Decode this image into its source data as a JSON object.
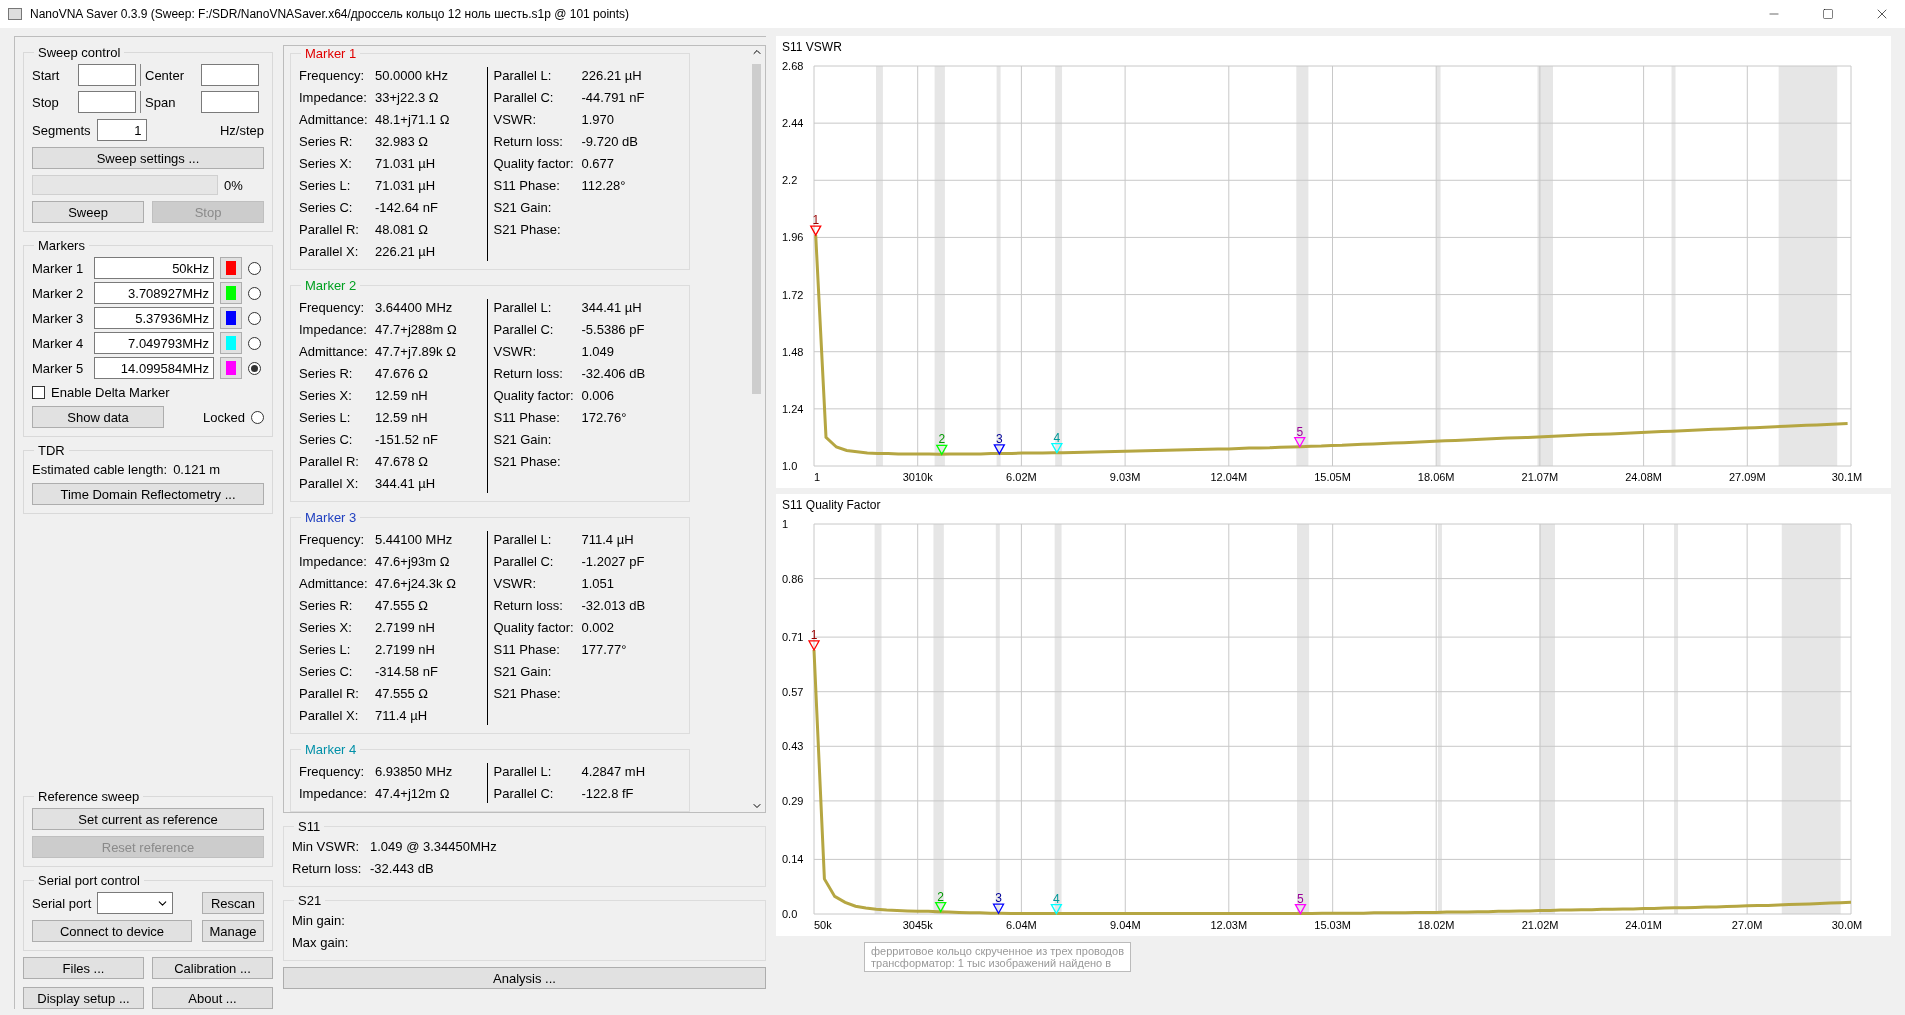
{
  "window": {
    "title": "NanoVNA Saver 0.3.9 (Sweep: F:/SDR/NanoVNASaver.x64/дроссель кольцо 12 ноль шесть.s1p @ 101 points)"
  },
  "sweep_control": {
    "title": "Sweep control",
    "start": "Start",
    "center": "Center",
    "stop": "Stop",
    "span": "Span",
    "segments": {
      "label": "Segments",
      "value": "1"
    },
    "unit": "Hz/step",
    "settings_button": "Sweep settings ...",
    "progress": {
      "level": 0,
      "reading": "0%"
    },
    "buttons": [
      {
        "label": "Sweep",
        "disabled": false
      },
      {
        "label": "Stop",
        "disabled": true
      }
    ]
  },
  "markers": {
    "title": "Markers",
    "items": [
      {
        "label": "Marker 1",
        "value": "50kHz",
        "color": "#ff0000",
        "selected": false
      },
      {
        "label": "Marker 2",
        "value": "3.708927MHz",
        "color": "#00ff00",
        "selected": false
      },
      {
        "label": "Marker 3",
        "value": "5.37936MHz",
        "color": "#0000ff",
        "selected": false
      },
      {
        "label": "Marker 4",
        "value": "7.049793MHz",
        "color": "#00ffff",
        "selected": false
      },
      {
        "label": "Marker 5",
        "value": "14.099584MHz",
        "color": "#ff00ff",
        "selected": true
      }
    ],
    "delta": {
      "label": "Enable Delta Marker",
      "checked": false
    },
    "show_data": "Show data",
    "locked": {
      "label": "Locked",
      "checked": false
    }
  },
  "tdr": {
    "title": "TDR",
    "label": "Estimated cable length:",
    "value": "0.121 m",
    "button": "Time Domain Reflectometry ..."
  },
  "reference_sweep": {
    "title": "Reference sweep",
    "buttons": [
      {
        "label": "Set current as reference",
        "disabled": false
      },
      {
        "label": "Reset reference",
        "disabled": true
      }
    ]
  },
  "serial_port": {
    "title": "Serial port control",
    "label": "Serial port",
    "rescan": "Rescan",
    "connect": "Connect to device",
    "manage": "Manage"
  },
  "bottom_buttons": [
    "Files ...",
    "Calibration ...",
    "Display setup ...",
    "About ..."
  ],
  "marker_data": [
    {
      "title": "Marker 1",
      "color": "#e00000",
      "left": [
        {
          "label": "Frequency:",
          "value": "50.0000 kHz"
        },
        {
          "label": "Impedance:",
          "value": "33+j22.3 Ω"
        },
        {
          "label": "Admittance:",
          "value": "48.1+j71.1 Ω"
        },
        {
          "label": "Series R:",
          "value": "32.983 Ω"
        },
        {
          "label": "Series X:",
          "value": "71.031 µH"
        },
        {
          "label": "Series L:",
          "value": "71.031 µH"
        },
        {
          "label": "Series C:",
          "value": "-142.64 nF"
        },
        {
          "label": "Parallel R:",
          "value": "48.081 Ω"
        },
        {
          "label": "Parallel X:",
          "value": "226.21 µH"
        }
      ],
      "right": [
        {
          "label": "Parallel L:",
          "value": "226.21 µH"
        },
        {
          "label": "Parallel C:",
          "value": "-44.791 nF"
        },
        {
          "label": "VSWR:",
          "value": "1.970"
        },
        {
          "label": "Return loss:",
          "value": "-9.720 dB"
        },
        {
          "label": "Quality factor:",
          "value": "0.677"
        },
        {
          "label": "S11 Phase:",
          "value": "112.28°"
        },
        {
          "label": "S21 Gain:"
        },
        {
          "label": "S21 Phase:"
        }
      ]
    },
    {
      "title": "Marker 2",
      "color": "#00a020",
      "left": [
        {
          "label": "Frequency:",
          "value": "3.64400 MHz"
        },
        {
          "label": "Impedance:",
          "value": "47.7+j288m Ω"
        },
        {
          "label": "Admittance:",
          "value": "47.7+j7.89k Ω"
        },
        {
          "label": "Series R:",
          "value": "47.676 Ω"
        },
        {
          "label": "Series X:",
          "value": "12.59 nH"
        },
        {
          "label": "Series L:",
          "value": "12.59 nH"
        },
        {
          "label": "Series C:",
          "value": "-151.52 nF"
        },
        {
          "label": "Parallel R:",
          "value": "47.678 Ω"
        },
        {
          "label": "Parallel X:",
          "value": "344.41 µH"
        }
      ],
      "right": [
        {
          "label": "Parallel L:",
          "value": "344.41 µH"
        },
        {
          "label": "Parallel C:",
          "value": "-5.5386 pF"
        },
        {
          "label": "VSWR:",
          "value": "1.049"
        },
        {
          "label": "Return loss:",
          "value": "-32.406 dB"
        },
        {
          "label": "Quality factor:",
          "value": "0.006"
        },
        {
          "label": "S11 Phase:",
          "value": "172.76°"
        },
        {
          "label": "S21 Gain:"
        },
        {
          "label": "S21 Phase:"
        }
      ]
    },
    {
      "title": "Marker 3",
      "color": "#2040c0",
      "left": [
        {
          "label": "Frequency:",
          "value": "5.44100 MHz"
        },
        {
          "label": "Impedance:",
          "value": "47.6+j93m Ω"
        },
        {
          "label": "Admittance:",
          "value": "47.6+j24.3k Ω"
        },
        {
          "label": "Series R:",
          "value": "47.555 Ω"
        },
        {
          "label": "Series X:",
          "value": "2.7199 nH"
        },
        {
          "label": "Series L:",
          "value": "2.7199 nH"
        },
        {
          "label": "Series C:",
          "value": "-314.58 nF"
        },
        {
          "label": "Parallel R:",
          "value": "47.555 Ω"
        },
        {
          "label": "Parallel X:",
          "value": "711.4 µH"
        }
      ],
      "right": [
        {
          "label": "Parallel L:",
          "value": "711.4 µH"
        },
        {
          "label": "Parallel C:",
          "value": "-1.2027 pF"
        },
        {
          "label": "VSWR:",
          "value": "1.051"
        },
        {
          "label": "Return loss:",
          "value": "-32.013 dB"
        },
        {
          "label": "Quality factor:",
          "value": "0.002"
        },
        {
          "label": "S11 Phase:",
          "value": "177.77°"
        },
        {
          "label": "S21 Gain:"
        },
        {
          "label": "S21 Phase:"
        }
      ]
    },
    {
      "title": "Marker 4",
      "color": "#0090a8",
      "left": [
        {
          "label": "Frequency:",
          "value": "6.93850 MHz"
        },
        {
          "label": "Impedance:",
          "value": "47.4+j12m Ω"
        }
      ],
      "right": [
        {
          "label": "Parallel L:",
          "value": "4.2847 mH"
        },
        {
          "label": "Parallel C:",
          "value": "-122.8 fF"
        }
      ]
    }
  ],
  "s11": {
    "title": "S11",
    "rows": [
      {
        "label": "Min VSWR:",
        "value": "1.049 @ 3.34450MHz"
      },
      {
        "label": "Return loss:",
        "value": "-32.443 dB"
      }
    ]
  },
  "s21": {
    "title": "S21",
    "rows": [
      {
        "label": "Min gain:"
      },
      {
        "label": "Max gain:"
      }
    ]
  },
  "analysis_button": "Analysis ...",
  "charts": [
    {
      "chart_data": {
        "type": "line",
        "title": "S11 VSWR",
        "grid": true,
        "xlim": [
          1,
          30100000
        ],
        "ylim": [
          1.0,
          2.68
        ],
        "xticks": [
          {
            "value": 1,
            "label": "1"
          },
          {
            "value": 3010000,
            "label": "3010k"
          },
          {
            "value": 6020000,
            "label": "6.02M"
          },
          {
            "value": 9030000,
            "label": "9.03M"
          },
          {
            "value": 12040000,
            "label": "12.04M"
          },
          {
            "value": 15050000,
            "label": "15.05M"
          },
          {
            "value": 18060000,
            "label": "18.06M"
          },
          {
            "value": 21070000,
            "label": "21.07M"
          },
          {
            "value": 24080000,
            "label": "24.08M"
          },
          {
            "value": 27090000,
            "label": "27.09M"
          },
          {
            "value": 30100000,
            "label": "30.1M"
          }
        ],
        "yticks": [
          {
            "value": 1.0,
            "label": "1.0"
          },
          1.24,
          1.48,
          1.72,
          1.96,
          {
            "value": 2.2,
            "label": "2.2"
          },
          2.44,
          2.68
        ],
        "x": [
          50000,
          349500,
          649000,
          948500,
          1248000,
          1547500,
          1847000,
          2146500,
          2446000,
          2745500,
          3045000,
          3344500,
          3644000,
          3943500,
          4243000,
          4542500,
          4842000,
          5141500,
          5441000,
          5740500,
          6040000,
          6339500,
          6639000,
          6938500,
          7238000,
          7537500,
          7837000,
          8136500,
          8436000,
          8735500,
          9035000,
          9334500,
          9634000,
          9933500,
          10233000,
          10532500,
          10832000,
          11131500,
          11431000,
          11730500,
          12030000,
          12329500,
          12629000,
          12928500,
          13228000,
          13527500,
          13827000,
          14126500,
          14426000,
          14725500,
          15025000,
          15324500,
          15624000,
          15923500,
          16223000,
          16522500,
          16822000,
          17121500,
          17421000,
          17720500,
          18020000,
          18319500,
          18619000,
          18918500,
          19218000,
          19517500,
          19817000,
          20116500,
          20416000,
          20715500,
          21015000,
          21314500,
          21614000,
          21913500,
          22213000,
          22512500,
          22812000,
          23111500,
          23411000,
          23710500,
          24010000,
          24309500,
          24609000,
          24908500,
          25208000,
          25507500,
          25807000,
          26106500,
          26406000,
          26705500,
          27005000,
          27304500,
          27604000,
          27903500,
          28203000,
          28502500,
          28802000,
          29101500,
          29401000,
          29700500,
          30000000
        ],
        "series": [
          {
            "color": "#b5a642",
            "values": [
              1.97,
              1.12,
              1.08,
              1.065,
              1.06,
              1.055,
              1.053,
              1.052,
              1.051,
              1.05,
              1.05,
              1.05,
              1.049,
              1.05,
              1.05,
              1.051,
              1.051,
              1.052,
              1.052,
              1.053,
              1.054,
              1.054,
              1.055,
              1.056,
              1.056,
              1.057,
              1.058,
              1.059,
              1.06,
              1.061,
              1.062,
              1.063,
              1.064,
              1.065,
              1.066,
              1.067,
              1.068,
              1.069,
              1.07,
              1.071,
              1.072,
              1.073,
              1.075,
              1.076,
              1.077,
              1.079,
              1.08,
              1.081,
              1.083,
              1.084,
              1.086,
              1.087,
              1.089,
              1.091,
              1.093,
              1.094,
              1.096,
              1.098,
              1.1,
              1.102,
              1.104,
              1.106,
              1.107,
              1.109,
              1.111,
              1.113,
              1.115,
              1.117,
              1.119,
              1.12,
              1.122,
              1.124,
              1.126,
              1.128,
              1.13,
              1.132,
              1.133,
              1.135,
              1.137,
              1.139,
              1.141,
              1.143,
              1.145,
              1.146,
              1.148,
              1.15,
              1.152,
              1.154,
              1.156,
              1.158,
              1.159,
              1.161,
              1.163,
              1.165,
              1.167,
              1.169,
              1.171,
              1.172,
              1.174,
              1.176,
              1.178
            ]
          }
        ],
        "bands": [
          {
            "axis": "x",
            "from": 1800000,
            "to": 2000000
          },
          {
            "axis": "x",
            "from": 3500000,
            "to": 3800000
          },
          {
            "axis": "x",
            "from": 5300000,
            "to": 5400000
          },
          {
            "axis": "x",
            "from": 7000000,
            "to": 7200000
          },
          {
            "axis": "x",
            "from": 14000000,
            "to": 14350000
          },
          {
            "axis": "x",
            "from": 18070000,
            "to": 18170000
          },
          {
            "axis": "x",
            "from": 21000000,
            "to": 21450000
          },
          {
            "axis": "x",
            "from": 24890000,
            "to": 24990000
          },
          {
            "axis": "x",
            "from": 28000000,
            "to": 29700000
          }
        ],
        "annotations": [
          {
            "text": "1",
            "x": 50000,
            "y": 1.97
          },
          {
            "text": "2",
            "x": 3708927,
            "y": 1.049
          },
          {
            "text": "3",
            "x": 5379360,
            "y": 1.051
          },
          {
            "text": "4",
            "x": 7049793,
            "y": 1.056
          },
          {
            "text": "5",
            "x": 14099584,
            "y": 1.081
          }
        ]
      }
    },
    {
      "chart_data": {
        "type": "line",
        "title": "S11 Quality Factor",
        "grid": true,
        "xlim": [
          50000,
          30000000
        ],
        "ylim": [
          0,
          1
        ],
        "xticks": [
          {
            "value": 50000,
            "label": "50k"
          },
          {
            "value": 3045000,
            "label": "3045k"
          },
          {
            "value": 6040000,
            "label": "6.04M"
          },
          {
            "value": 9040000,
            "label": "9.04M"
          },
          {
            "value": 12030000,
            "label": "12.03M"
          },
          {
            "value": 15030000,
            "label": "15.03M"
          },
          {
            "value": 18020000,
            "label": "18.02M"
          },
          {
            "value": 21020000,
            "label": "21.02M"
          },
          {
            "value": 24010000,
            "label": "24.01M"
          },
          {
            "value": 27000000,
            "label": "27.0M"
          },
          {
            "value": 30000000,
            "label": "30.0M"
          }
        ],
        "yticks": [
          {
            "value": 0,
            "label": "0.0"
          },
          0.14,
          0.29,
          0.43,
          0.57,
          0.71,
          0.86,
          1
        ],
        "x": [
          50000,
          349500,
          649000,
          948500,
          1248000,
          1547500,
          1847000,
          2146500,
          2446000,
          2745500,
          3045000,
          3344500,
          3644000,
          3943500,
          4243000,
          4542500,
          4842000,
          5141500,
          5441000,
          5740500,
          6040000,
          6339500,
          6639000,
          6938500,
          7238000,
          7537500,
          7837000,
          8136500,
          8436000,
          8735500,
          9035000,
          9334500,
          9634000,
          9933500,
          10233000,
          10532500,
          10832000,
          11131500,
          11431000,
          11730500,
          12030000,
          12329500,
          12629000,
          12928500,
          13228000,
          13527500,
          13827000,
          14126500,
          14426000,
          14725500,
          15025000,
          15324500,
          15624000,
          15923500,
          16223000,
          16522500,
          16822000,
          17121500,
          17421000,
          17720500,
          18020000,
          18319500,
          18619000,
          18918500,
          19218000,
          19517500,
          19817000,
          20116500,
          20416000,
          20715500,
          21015000,
          21314500,
          21614000,
          21913500,
          22213000,
          22512500,
          22812000,
          23111500,
          23411000,
          23710500,
          24010000,
          24309500,
          24609000,
          24908500,
          25208000,
          25507500,
          25807000,
          26106500,
          26406000,
          26705500,
          27005000,
          27304500,
          27604000,
          27903500,
          28203000,
          28502500,
          28802000,
          29101500,
          29401000,
          29700500,
          30000000
        ],
        "series": [
          {
            "color": "#b5a642",
            "values": [
              0.677,
              0.09,
              0.045,
              0.03,
              0.02,
              0.015,
              0.012,
              0.01,
              0.009,
              0.008,
              0.007,
              0.007,
              0.006,
              0.005,
              0.004,
              0.003,
              0.003,
              0.002,
              0.002,
              0.001,
              0.001,
              0.001,
              0.001,
              0.001,
              0.001,
              0.001,
              0.001,
              0.001,
              0.001,
              0.001,
              0.001,
              0.001,
              0.001,
              0.001,
              0.001,
              0.001,
              0.001,
              0.001,
              0.001,
              0.001,
              0.001,
              0.001,
              0.001,
              0.001,
              0.001,
              0.001,
              0.001,
              0.001,
              0.001,
              0.002,
              0.002,
              0.002,
              0.002,
              0.002,
              0.003,
              0.003,
              0.003,
              0.003,
              0.004,
              0.004,
              0.004,
              0.005,
              0.005,
              0.005,
              0.006,
              0.006,
              0.007,
              0.007,
              0.008,
              0.008,
              0.009,
              0.009,
              0.01,
              0.01,
              0.011,
              0.011,
              0.012,
              0.012,
              0.013,
              0.013,
              0.014,
              0.014,
              0.015,
              0.016,
              0.016,
              0.017,
              0.018,
              0.018,
              0.019,
              0.02,
              0.021,
              0.022,
              0.022,
              0.023,
              0.024,
              0.025,
              0.026,
              0.027,
              0.028,
              0.029,
              0.03
            ]
          }
        ],
        "bands": [
          {
            "axis": "x",
            "from": 1800000,
            "to": 2000000
          },
          {
            "axis": "x",
            "from": 3500000,
            "to": 3800000
          },
          {
            "axis": "x",
            "from": 5300000,
            "to": 5400000
          },
          {
            "axis": "x",
            "from": 7000000,
            "to": 7200000
          },
          {
            "axis": "x",
            "from": 14000000,
            "to": 14350000
          },
          {
            "axis": "x",
            "from": 18070000,
            "to": 18170000
          },
          {
            "axis": "x",
            "from": 21000000,
            "to": 21450000
          },
          {
            "axis": "x",
            "from": 24890000,
            "to": 24990000
          },
          {
            "axis": "x",
            "from": 28000000,
            "to": 29700000
          }
        ],
        "annotations": [
          {
            "text": "1",
            "x": 50000,
            "y": 0.677
          },
          {
            "text": "2",
            "x": 3708927,
            "y": 0.006
          },
          {
            "text": "3",
            "x": 5379360,
            "y": 0.002
          },
          {
            "text": "4",
            "x": 7049793,
            "y": 0.001
          },
          {
            "text": "5",
            "x": 14099584,
            "y": 0.001
          }
        ]
      }
    }
  ],
  "tooltip": {
    "lines": [
      "ферритовое кольцо скрученное из трех проводов",
      "трансформатор: 1 тыс изображений найдено в"
    ]
  }
}
